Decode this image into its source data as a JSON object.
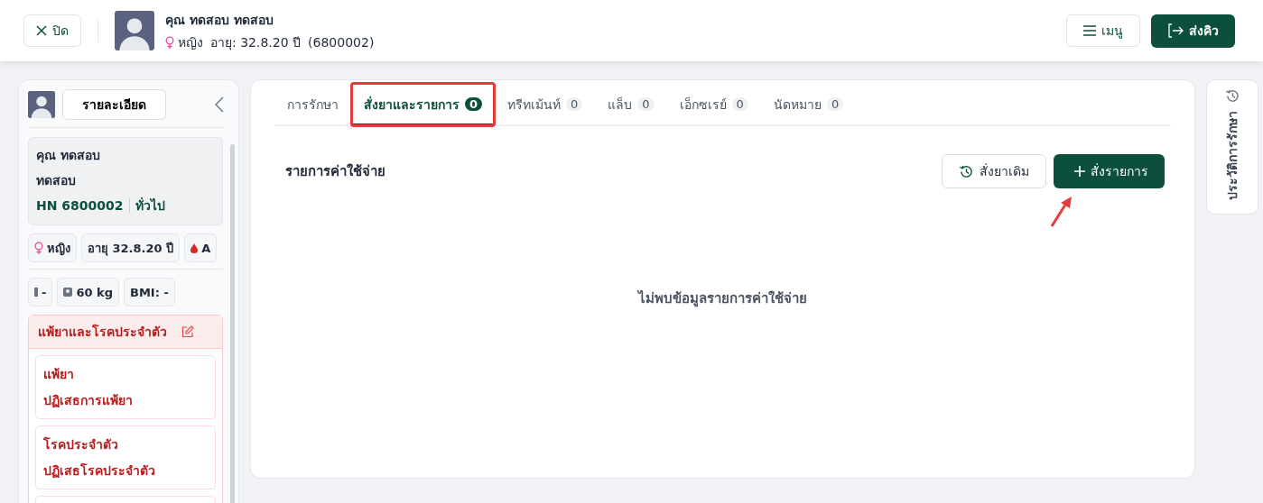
{
  "header": {
    "close_button": "ปิด",
    "patient_name": "คุณ ทดสอบ ทดสอบ",
    "gender": "หญิง",
    "age": "อายุ: 32.8.20 ปี",
    "hn": "(6800002)",
    "menu_button": "เมนู",
    "send_queue_button": "ส่งคิว"
  },
  "sidebar": {
    "details_button": "รายละเอียด",
    "name_line_1": "คุณ ทดสอบ",
    "name_line_2": "ทดสอบ",
    "hn": "HN 6800002",
    "patient_type": "ทั่วไป",
    "chips": [
      {
        "kind": "gender",
        "text": "หญิง"
      },
      {
        "kind": "age",
        "text": "อายุ 32.8.20 ปี"
      },
      {
        "kind": "blood",
        "text": "A"
      }
    ],
    "vitals": [
      {
        "kind": "height",
        "text": "-"
      },
      {
        "kind": "weight",
        "text": "60 kg"
      },
      {
        "kind": "plain",
        "text": "BMI: -"
      }
    ],
    "allergy_section": {
      "title": "แพ้ยาและโรคประจำตัว",
      "cards": [
        {
          "title": "แพ้ยา",
          "value": "ปฏิเสธการแพ้ยา"
        },
        {
          "title": "โรคประจำตัว",
          "value": "ปฏิเสธโรคประจำตัว"
        }
      ]
    }
  },
  "tabs": [
    {
      "label": "การรักษา",
      "selected": false,
      "highlighted": false
    },
    {
      "label": "สั่งยาและรายการ",
      "count": "0",
      "selected": true,
      "highlighted": true
    },
    {
      "label": "ทรีทเม้นท์",
      "count": "0",
      "selected": false,
      "highlighted": false
    },
    {
      "label": "แล็บ",
      "count": "0",
      "selected": false,
      "highlighted": false
    },
    {
      "label": "เอ็กซเรย์",
      "count": "0",
      "selected": false,
      "highlighted": false
    },
    {
      "label": "นัดหมาย",
      "count": "0",
      "selected": false,
      "highlighted": false
    }
  ],
  "expenses": {
    "title": "รายการค่าใช้จ่าย",
    "previous_order_button": "สั่งยาเดิม",
    "order_button": "สั่งรายการ",
    "empty_message": "ไม่พบข้อมูลรายการค่าใช้จ่าย",
    "arrow_annotation": true
  },
  "history_tab": {
    "label": "ประวัติการรักษา"
  }
}
